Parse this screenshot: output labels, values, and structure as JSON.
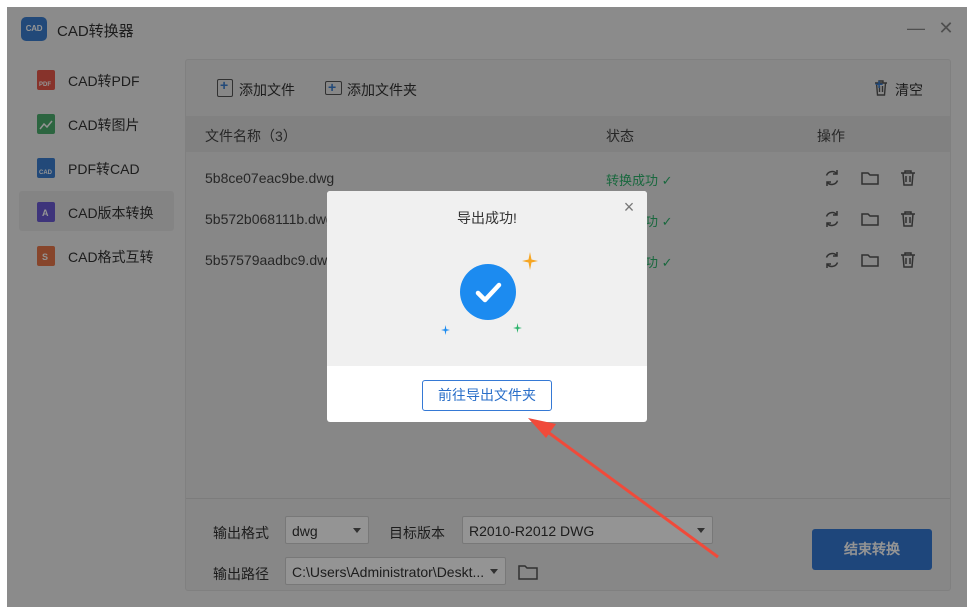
{
  "app": {
    "logo_text": "CAD",
    "title": "CAD转换器"
  },
  "window_controls": {
    "minimize": "—",
    "close": "✕"
  },
  "sidebar": {
    "items": [
      {
        "label": "CAD转PDF",
        "icon": "pdf-icon",
        "icon_text": "PDF",
        "color": "#e8584a"
      },
      {
        "label": "CAD转图片",
        "icon": "image-icon",
        "icon_text": "",
        "color": "#4caf6e"
      },
      {
        "label": "PDF转CAD",
        "icon": "cad-icon",
        "icon_text": "CAD",
        "color": "#3b7fd0"
      },
      {
        "label": "CAD版本转换",
        "icon": "version-icon",
        "icon_text": "A",
        "color": "#6b5bd4",
        "active": true
      },
      {
        "label": "CAD格式互转",
        "icon": "format-icon",
        "icon_text": "S",
        "color": "#e8784a"
      }
    ]
  },
  "toolbar": {
    "add_file": "添加文件",
    "add_folder": "添加文件夹",
    "clear": "清空"
  },
  "table": {
    "headers": {
      "name": "文件名称（3）",
      "status": "状态",
      "actions": "操作"
    },
    "rows": [
      {
        "name": "5b8ce07eac9be.dwg",
        "status": "转换成功 ✓"
      },
      {
        "name": "5b572b068111b.dwg",
        "status": "转换成功 ✓"
      },
      {
        "name": "5b57579aadbc9.dwg",
        "status": "转换成功 ✓"
      }
    ]
  },
  "settings": {
    "format_label": "输出格式",
    "format_value": "dwg",
    "version_label": "目标版本",
    "version_value": "R2010-R2012 DWG",
    "path_label": "输出路径",
    "path_value": "C:\\Users\\Administrator\\Deskt..."
  },
  "convert_button": "结束转换",
  "dialog": {
    "title": "导出成功!",
    "close": "×",
    "button": "前往导出文件夹",
    "accent_color": "#1c8bf0"
  },
  "annotation": {
    "arrow_color": "#f04a3a"
  }
}
